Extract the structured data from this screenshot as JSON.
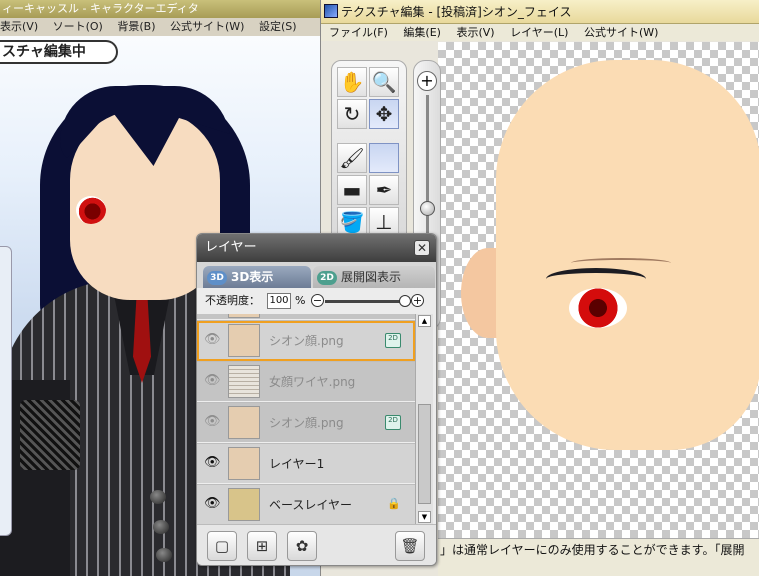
{
  "background_window": {
    "title": "ィーキャッスル - キャラクターエディタ",
    "menu": [
      "表示(V)",
      "ソート(O)",
      "背景(B)",
      "公式サイト(W)",
      "設定(S)"
    ],
    "banner": "スチャ編集中"
  },
  "texture_window": {
    "title": "テクスチャ編集 - [投稿済]シオン_フェイス",
    "menu": [
      "ファイル(F)",
      "編集(E)",
      "表示(V)",
      "レイヤー(L)",
      "公式サイト(W)"
    ],
    "status_text": "」は通常レイヤーにのみ使用することができます。「展開"
  },
  "tools": {
    "hand": "✋",
    "zoom": "🔍",
    "rotate": "↻",
    "move": "✥",
    "brush": "🖌",
    "eraser": "▬",
    "eyedropper": "✒",
    "bucket": "🪣",
    "stamp": "⊥"
  },
  "layer_panel": {
    "title": "レイヤー",
    "close_label": "✕",
    "tab_3d_badge": "3D",
    "tab_3d_label": "3D表示",
    "tab_2d_badge": "2D",
    "tab_2d_label": "展開図表示",
    "opacity_label": "不透明度：",
    "opacity_value": "100",
    "opacity_unit": "%",
    "layers": [
      {
        "name": "シオン顔.png",
        "tag": "2D"
      },
      {
        "name": "女顔ワイヤ.png",
        "tag": ""
      },
      {
        "name": "シオン顔.png",
        "tag": "2D"
      },
      {
        "name": "レイヤー1",
        "tag": ""
      },
      {
        "name": "ベースレイヤー",
        "tag": ""
      }
    ],
    "tag_icon": "2D"
  }
}
